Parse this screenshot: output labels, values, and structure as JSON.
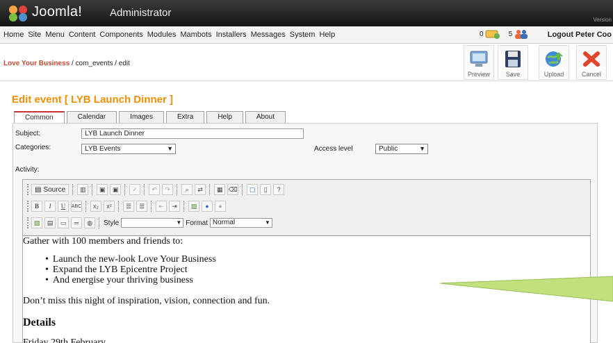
{
  "header": {
    "brand": "Joomla!",
    "app_title": "Administrator",
    "version_label": "Version"
  },
  "menu": [
    "Home",
    "Site",
    "Menu",
    "Content",
    "Components",
    "Modules",
    "Mambots",
    "Installers",
    "Messages",
    "System",
    "Help"
  ],
  "status": {
    "messages_count": "0",
    "users_count": "5",
    "logout_label": "Logout Peter Coo"
  },
  "breadcrumb": {
    "site": "Love Your Business",
    "path": " / com_events / edit"
  },
  "toolbar": {
    "preview": "Preview",
    "save": "Save",
    "upload": "Upload",
    "cancel": "Cancel"
  },
  "page_title": "Edit event  [ LYB Launch Dinner ]",
  "tabs": [
    "Common",
    "Calendar",
    "Images",
    "Extra",
    "Help",
    "About"
  ],
  "form": {
    "subject_label": "Subject:",
    "subject_value": "LYB Launch Dinner",
    "categories_label": "Categories:",
    "categories_value": "LYB Events",
    "access_label": "Access level",
    "access_value": "Public",
    "activity_label": "Activity:"
  },
  "editor": {
    "source_label": "Source",
    "style_label": "Style",
    "style_value": "",
    "format_label": "Format",
    "format_value": "Normal"
  },
  "content": {
    "intro": "Gather with 100 members and friends to:",
    "bullets": [
      "Launch the new-look Love Your Business",
      "Expand the LYB Epicentre Project",
      "And energise your thriving business"
    ],
    "closing": "Don’t miss this night of inspiration, vision, connection and fun.",
    "details_heading": "Details",
    "date": "Friday 29th February"
  },
  "colors": {
    "accent_orange": "#f28f00",
    "breadcrumb_red": "#c64934",
    "header_dark": "#1e1e1e",
    "callout_green": "#c2e17c"
  }
}
